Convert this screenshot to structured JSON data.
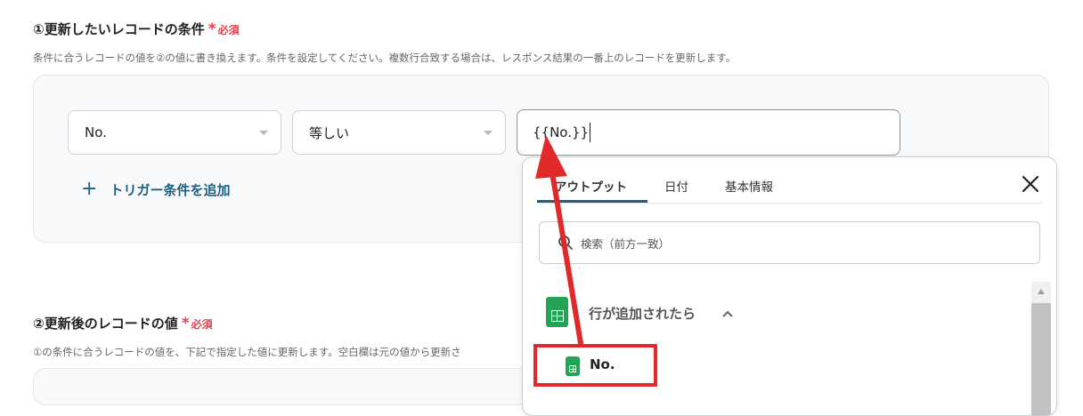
{
  "section1": {
    "title": "①更新したいレコードの条件",
    "required_star": "*",
    "required_text": "必須",
    "description": "条件に合うレコードの値を②の値に書き換えます。条件を設定してください。複数行合致する場合は、レスポンス結果の一番上のレコードを更新します。",
    "condition": {
      "field_value": "No.",
      "operator_value": "等しい",
      "input_value": "{{No.}}"
    },
    "add_trigger": {
      "icon": "+",
      "label": "トリガー条件を追加"
    }
  },
  "section2": {
    "title": "②更新後のレコードの値",
    "required_star": "*",
    "required_text": "必須",
    "description": "①の条件に合うレコードの値を、下記で指定した値に更新します。空白欄は元の値から更新さ"
  },
  "popup": {
    "tabs": [
      {
        "label": "アウトプット",
        "active": true
      },
      {
        "label": "日付",
        "active": false
      },
      {
        "label": "基本情報",
        "active": false
      }
    ],
    "close_icon": "close-icon",
    "search_placeholder": "検索（前方一致）",
    "group": {
      "label": "行が追加されたら",
      "icon": "google-sheets-icon",
      "expanded": true
    },
    "items": [
      {
        "label": "No."
      }
    ]
  },
  "annotation": {
    "highlight_color": "#e02a2a"
  },
  "colors": {
    "accent": "#1d5f80",
    "required": "#e5404e",
    "sheets_green": "#23a455"
  }
}
